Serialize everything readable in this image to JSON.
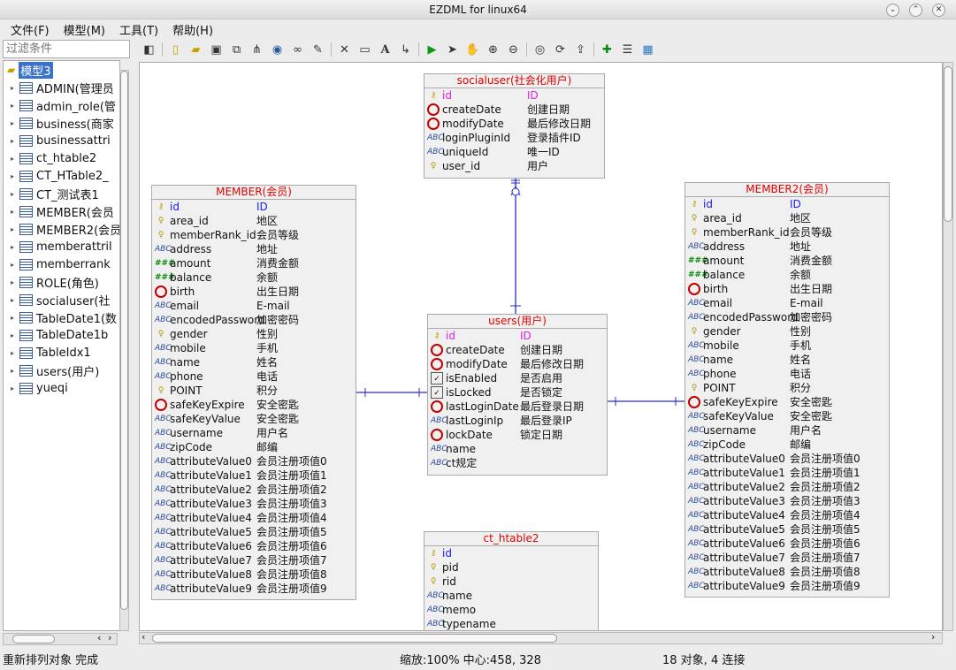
{
  "window": {
    "title": "EZDML for linux64"
  },
  "menu": [
    "文件(F)",
    "模型(M)",
    "工具(T)",
    "帮助(H)"
  ],
  "filter": {
    "placeholder": "过滤条件"
  },
  "tree": {
    "root": "模型3",
    "items": [
      "ADMIN(管理员",
      "admin_role(管",
      "business(商家",
      "businessattri",
      "ct_htable2",
      "CT_HTable2_",
      "CT_测试表1",
      "MEMBER(会员",
      "MEMBER2(会员",
      "memberattril",
      "memberrank",
      "ROLE(角色)",
      "socialuser(社",
      "TableDate1(数",
      "TableDate1b",
      "TableIdx1",
      "users(用户)",
      "yueqi"
    ]
  },
  "tables": {
    "socialuser": {
      "title": "socialuser(社会化用户)",
      "fields": [
        [
          "pkid",
          "id",
          "ID"
        ],
        [
          "clk",
          "createDate",
          "创建日期"
        ],
        [
          "clk",
          "modifyDate",
          "最后修改日期"
        ],
        [
          "abc",
          "loginPluginId",
          "登录插件ID"
        ],
        [
          "abc",
          "uniqueId",
          "唯一ID"
        ],
        [
          "key",
          "user_id",
          "用户"
        ]
      ]
    },
    "member": {
      "title": "MEMBER(会员)",
      "fields": [
        [
          "pk",
          "id",
          "ID"
        ],
        [
          "key",
          "area_id",
          "地区"
        ],
        [
          "key",
          "memberRank_id",
          "会员等级"
        ],
        [
          "abc",
          "address",
          "地址"
        ],
        [
          "num",
          "amount",
          "消费金额"
        ],
        [
          "num",
          "balance",
          "余额"
        ],
        [
          "clk",
          "birth",
          "出生日期"
        ],
        [
          "abc",
          "email",
          "E-mail"
        ],
        [
          "abc",
          "encodedPassword",
          "加密密码"
        ],
        [
          "key",
          "gender",
          "性别"
        ],
        [
          "abc",
          "mobile",
          "手机"
        ],
        [
          "abc",
          "name",
          "姓名"
        ],
        [
          "abc",
          "phone",
          "电话"
        ],
        [
          "key",
          "POINT",
          "积分"
        ],
        [
          "clk",
          "safeKeyExpire",
          "安全密匙"
        ],
        [
          "abc",
          "safeKeyValue",
          "安全密匙"
        ],
        [
          "abc",
          "username",
          "用户名"
        ],
        [
          "abc",
          "zipCode",
          "邮编"
        ],
        [
          "abc",
          "attributeValue0",
          "会员注册项值0"
        ],
        [
          "abc",
          "attributeValue1",
          "会员注册项值1"
        ],
        [
          "abc",
          "attributeValue2",
          "会员注册项值2"
        ],
        [
          "abc",
          "attributeValue3",
          "会员注册项值3"
        ],
        [
          "abc",
          "attributeValue4",
          "会员注册项值4"
        ],
        [
          "abc",
          "attributeValue5",
          "会员注册项值5"
        ],
        [
          "abc",
          "attributeValue6",
          "会员注册项值6"
        ],
        [
          "abc",
          "attributeValue7",
          "会员注册项值7"
        ],
        [
          "abc",
          "attributeValue8",
          "会员注册项值8"
        ],
        [
          "abc",
          "attributeValue9",
          "会员注册项值9"
        ]
      ]
    },
    "member2": {
      "title": "MEMBER2(会员)",
      "fields": [
        [
          "pk",
          "id",
          "ID"
        ],
        [
          "key",
          "area_id",
          "地区"
        ],
        [
          "key",
          "memberRank_id",
          "会员等级"
        ],
        [
          "abc",
          "address",
          "地址"
        ],
        [
          "num",
          "amount",
          "消费金额"
        ],
        [
          "num",
          "balance",
          "余额"
        ],
        [
          "clk",
          "birth",
          "出生日期"
        ],
        [
          "abc",
          "email",
          "E-mail"
        ],
        [
          "abc",
          "encodedPassword",
          "加密密码"
        ],
        [
          "key",
          "gender",
          "性别"
        ],
        [
          "abc",
          "mobile",
          "手机"
        ],
        [
          "abc",
          "name",
          "姓名"
        ],
        [
          "abc",
          "phone",
          "电话"
        ],
        [
          "key",
          "POINT",
          "积分"
        ],
        [
          "clk",
          "safeKeyExpire",
          "安全密匙"
        ],
        [
          "abc",
          "safeKeyValue",
          "安全密匙"
        ],
        [
          "abc",
          "username",
          "用户名"
        ],
        [
          "abc",
          "zipCode",
          "邮编"
        ],
        [
          "abc",
          "attributeValue0",
          "会员注册项值0"
        ],
        [
          "abc",
          "attributeValue1",
          "会员注册项值1"
        ],
        [
          "abc",
          "attributeValue2",
          "会员注册项值2"
        ],
        [
          "abc",
          "attributeValue3",
          "会员注册项值3"
        ],
        [
          "abc",
          "attributeValue4",
          "会员注册项值4"
        ],
        [
          "abc",
          "attributeValue5",
          "会员注册项值5"
        ],
        [
          "abc",
          "attributeValue6",
          "会员注册项值6"
        ],
        [
          "abc",
          "attributeValue7",
          "会员注册项值7"
        ],
        [
          "abc",
          "attributeValue8",
          "会员注册项值8"
        ],
        [
          "abc",
          "attributeValue9",
          "会员注册项值9"
        ]
      ]
    },
    "users": {
      "title": "users(用户)",
      "fields": [
        [
          "pkid",
          "id",
          "ID"
        ],
        [
          "clk",
          "createDate",
          "创建日期"
        ],
        [
          "clk",
          "modifyDate",
          "最后修改日期"
        ],
        [
          "chk",
          "isEnabled",
          "是否启用"
        ],
        [
          "chk",
          "isLocked",
          "是否锁定"
        ],
        [
          "clk",
          "lastLoginDate",
          "最后登录日期"
        ],
        [
          "abc",
          "lastLoginIp",
          "最后登录IP"
        ],
        [
          "clk",
          "lockDate",
          "锁定日期"
        ],
        [
          "abc",
          "name",
          ""
        ],
        [
          "abc",
          "ct规定",
          ""
        ]
      ]
    },
    "ct_htable2": {
      "title": "ct_htable2",
      "fields": [
        [
          "pk",
          "id",
          ""
        ],
        [
          "key",
          "pid",
          ""
        ],
        [
          "key",
          "rid",
          ""
        ],
        [
          "abc",
          "name",
          ""
        ],
        [
          "abc",
          "memo",
          ""
        ],
        [
          "abc",
          "typename",
          ""
        ]
      ]
    }
  },
  "status": {
    "left": "重新排列对象 完成",
    "center": "缩放:100% 中心:458, 328",
    "right": "18 对象, 4 连接"
  }
}
